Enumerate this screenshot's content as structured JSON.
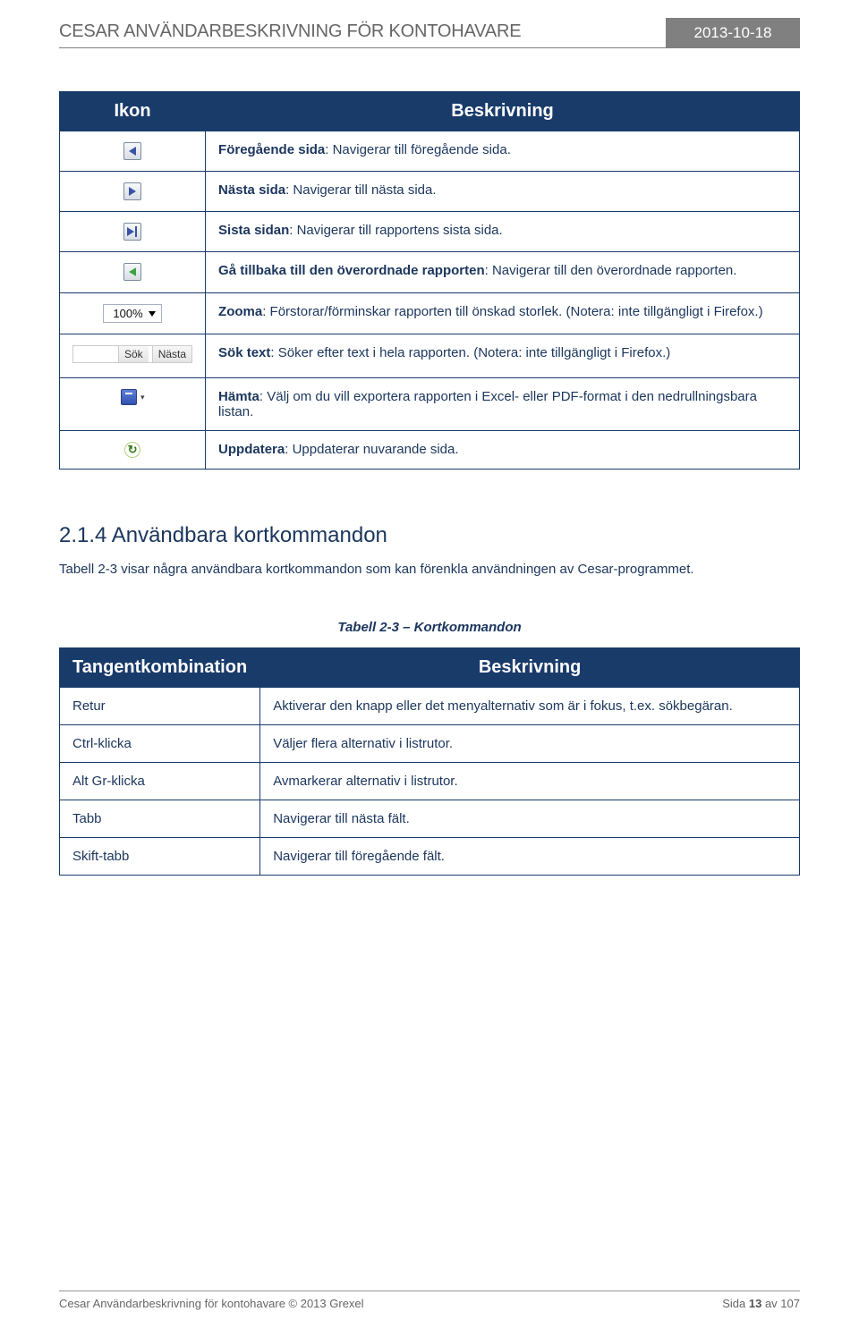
{
  "header": {
    "title": "CESAR ANVÄNDARBESKRIVNING FÖR KONTOHAVARE",
    "date": "2013-10-18"
  },
  "table1": {
    "hdr_icon": "Ikon",
    "hdr_desc": "Beskrivning",
    "rows": [
      {
        "term": "Föregående sida",
        "desc": ": Navigerar till föregående sida."
      },
      {
        "term": "Nästa sida",
        "desc": ": Navigerar till nästa sida."
      },
      {
        "term": "Sista sidan",
        "desc": ": Navigerar till rapportens sista sida."
      },
      {
        "term": "Gå tillbaka till den överordnade rapporten",
        "desc": ": Navigerar till den överordnade rapporten."
      },
      {
        "term": "Zooma",
        "desc": ": Förstorar/förminskar rapporten till önskad storlek. (Notera: inte tillgängligt i Firefox.)"
      },
      {
        "term": "Sök text",
        "desc": ": Söker efter text i hela rapporten. (Notera: inte tillgängligt i Firefox.)"
      },
      {
        "term": "Hämta",
        "desc": ": Välj om du vill exportera rapporten i Excel- eller PDF-format i den nedrullningsbara listan."
      },
      {
        "term": "Uppdatera",
        "desc": ": Uppdaterar nuvarande sida."
      }
    ]
  },
  "zoom_label": "100%",
  "search_btn1": "Sök",
  "search_btn2": "Nästa",
  "section": {
    "heading": "2.1.4 Användbara kortkommandon",
    "para": "Tabell 2-3 visar några användbara kortkommandon som kan förenkla användningen av Cesar-programmet."
  },
  "caption": "Tabell 2-3 – Kortkommandon",
  "table2": {
    "hdr_key": "Tangentkombination",
    "hdr_desc": "Beskrivning",
    "rows": [
      {
        "k": "Retur",
        "d": "Aktiverar den knapp eller det menyalternativ som är i fokus, t.ex. sökbegäran."
      },
      {
        "k": "Ctrl-klicka",
        "d": "Väljer flera alternativ i listrutor."
      },
      {
        "k": "Alt Gr-klicka",
        "d": "Avmarkerar alternativ i listrutor."
      },
      {
        "k": "Tabb",
        "d": "Navigerar till nästa fält."
      },
      {
        "k": "Skift-tabb",
        "d": "Navigerar till föregående fält."
      }
    ]
  },
  "footer": {
    "left": "Cesar Användarbeskrivning för kontohavare   © 2013 Grexel",
    "right_prefix": "Sida ",
    "right_page": "13",
    "right_suffix": " av 107"
  }
}
